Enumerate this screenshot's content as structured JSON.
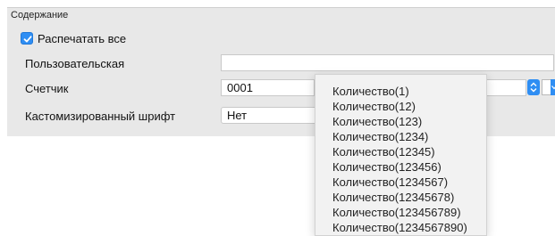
{
  "panel": {
    "title": "Содержание"
  },
  "print_all": {
    "label": "Распечатать все",
    "checked": true
  },
  "custom": {
    "label": "Пользовательская",
    "value": ""
  },
  "counter": {
    "label": "Счетчик",
    "value": "0001"
  },
  "custom_font": {
    "label": "Кастомизированный шрифт",
    "value": "Нет"
  },
  "count_dropdown": {
    "options": [
      "Количество(1)",
      "Количество(12)",
      "Количество(123)",
      "Количество(1234)",
      "Количество(12345)",
      "Количество(123456)",
      "Количество(1234567)",
      "Количество(12345678)",
      "Количество(123456789)",
      "Количество(1234567890)"
    ]
  },
  "icons": {
    "checkbox": "check-icon",
    "stepper": "up-down-chevron-icon",
    "select_arrow": "chevron-down-icon"
  },
  "colors": {
    "accent": "#2f8ef3",
    "panel_bg": "#e8e8e8",
    "dropdown_bg": "#f2f2f2"
  }
}
